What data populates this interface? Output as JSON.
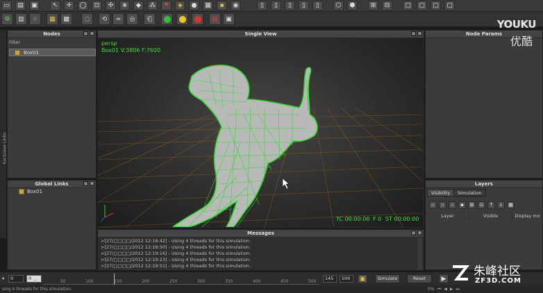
{
  "panels": {
    "nodes": {
      "title": "Nodes",
      "filter_label": "Filter",
      "items": [
        "Box01"
      ]
    },
    "global_links": {
      "title": "Global Links",
      "items": [
        "Box01"
      ]
    },
    "single_view": {
      "title": "Single View",
      "camera": "persp",
      "object_info": "Box01 V:3806 F:7600",
      "tc": "TC 00:00:00",
      "frame": "F 0",
      "st": "ST 00:00:00"
    },
    "node_params": {
      "title": "Node Params"
    },
    "layers": {
      "title": "Layers",
      "tabs": [
        "Visibility",
        "Simulation"
      ],
      "columns": [
        "Layer",
        "Visible",
        "Display mo"
      ]
    },
    "messages": {
      "title": "Messages",
      "lines": [
        ">[27/□□□□/2012 12:18:42] - Using 4 threads for this simulation.",
        ">[27/□□□□/2012 12:18:50] - Using 4 threads for this simulation.",
        ">[27/□□□□/2012 12:19:16] - Using 4 threads for this simulation.",
        ">[27/□□□□/2012 12:19:23] - Using 4 threads for this simulation.",
        ">[27/□□□□/2012 12:19:51] - Using 4 threads for this simulation."
      ]
    },
    "side_tab": "Exclusive Links"
  },
  "timeline": {
    "start": "0",
    "current": "0",
    "ticks": [
      "0",
      "50",
      "100",
      "150",
      "200",
      "250",
      "300",
      "350",
      "400",
      "450",
      "500"
    ],
    "end_a": "145",
    "end_b": "500",
    "simulate_label": "Simulate",
    "reset_label": "Reset"
  },
  "status": {
    "text": "sing 4 threads for this simulation.",
    "zoom": "0%"
  },
  "watermark": {
    "brand": "YOUKU",
    "brand_cn": "优酷",
    "site_cn": "朱峰社区",
    "site": "ZF3D.COM"
  },
  "colors": {
    "wireframe": "#33dd33",
    "grid": "#9a6a1e",
    "overlay_text": "#3fdc3f"
  }
}
